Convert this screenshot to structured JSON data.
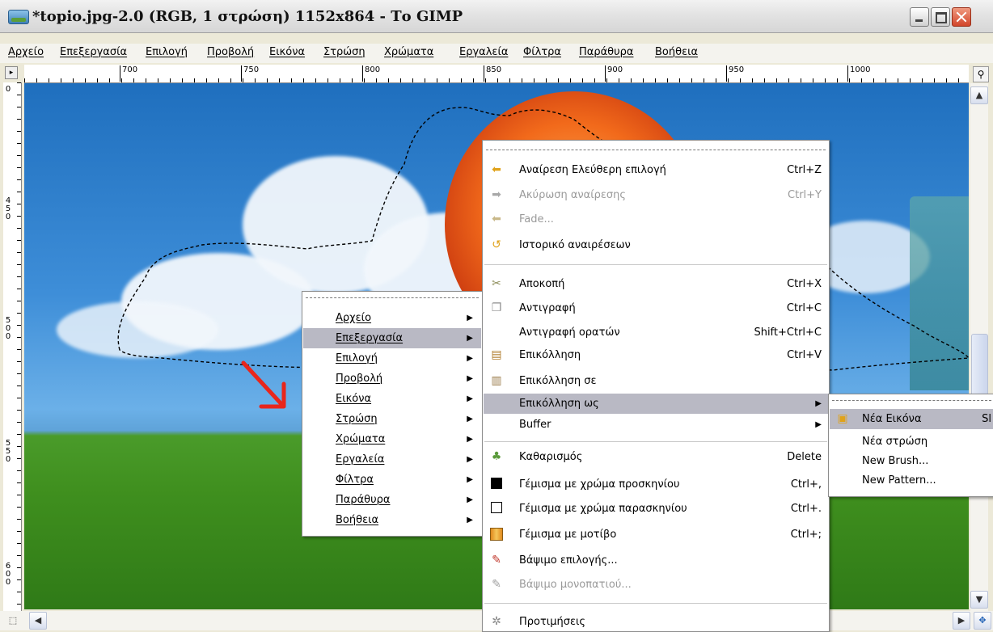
{
  "window": {
    "title": "*topio.jpg-2.0 (RGB, 1 στρώση) 1152x864 - Το GIMP"
  },
  "menubar": [
    "Αρχείο",
    "Επεξεργασία",
    "Επιλογή",
    "Προβολή",
    "Εικόνα",
    "Στρώση",
    "Χρώματα",
    "Εργαλεία",
    "Φίλτρα",
    "Παράθυρα",
    "Βοήθεια"
  ],
  "ruler": {
    "h_labels": [
      "700",
      "750",
      "800",
      "850",
      "900",
      "950",
      "1000"
    ],
    "v_labels": [
      "0",
      "4\n5\n0",
      "5\n0\n0",
      "5\n5\n0",
      "6\n0\n0"
    ]
  },
  "context_menu": {
    "items": [
      {
        "label": "Αρχείο",
        "submenu": true
      },
      {
        "label": "Επεξεργασία",
        "submenu": true,
        "highlighted": true
      },
      {
        "label": "Επιλογή",
        "submenu": true
      },
      {
        "label": "Προβολή",
        "submenu": true
      },
      {
        "label": "Εικόνα",
        "submenu": true
      },
      {
        "label": "Στρώση",
        "submenu": true
      },
      {
        "label": "Χρώματα",
        "submenu": true
      },
      {
        "label": "Εργαλεία",
        "submenu": true
      },
      {
        "label": "Φίλτρα",
        "submenu": true
      },
      {
        "label": "Παράθυρα",
        "submenu": true
      },
      {
        "label": "Βοήθεια",
        "submenu": true
      }
    ]
  },
  "edit_menu": {
    "items": [
      {
        "label": "Αναίρεση Ελεύθερη επιλογή",
        "shortcut": "Ctrl+Z",
        "icon": "undo-icon"
      },
      {
        "label": "Ακύρωση αναίρεσης",
        "shortcut": "Ctrl+Y",
        "icon": "redo-icon",
        "disabled": true
      },
      {
        "label": "Fade...",
        "shortcut": "",
        "icon": "fade-icon",
        "disabled": true
      },
      {
        "label": "Ιστορικό αναιρέσεων",
        "shortcut": "",
        "icon": "undo-history-icon"
      },
      {
        "label": "Αποκοπή",
        "shortcut": "Ctrl+X",
        "icon": "cut-icon"
      },
      {
        "label": "Αντιγραφή",
        "shortcut": "Ctrl+C",
        "icon": "copy-icon"
      },
      {
        "label": "Αντιγραφή ορατών",
        "shortcut": "Shift+Ctrl+C",
        "icon": ""
      },
      {
        "label": "Επικόλληση",
        "shortcut": "Ctrl+V",
        "icon": "paste-icon"
      },
      {
        "label": "Επικόλληση σε",
        "shortcut": "",
        "icon": "paste-into-icon"
      },
      {
        "label": "Επικόλληση ως",
        "shortcut": "",
        "icon": "",
        "submenu": true,
        "highlighted": true
      },
      {
        "label": "Buffer",
        "shortcut": "",
        "icon": "",
        "submenu": true
      },
      {
        "label": "Καθαρισμός",
        "shortcut": "Delete",
        "icon": "clear-icon"
      },
      {
        "label": "Γέμισμα με χρώμα προσκηνίου",
        "shortcut": "Ctrl+,",
        "icon": "fg-fill-icon"
      },
      {
        "label": "Γέμισμα με χρώμα παρασκηνίου",
        "shortcut": "Ctrl+.",
        "icon": "bg-fill-icon"
      },
      {
        "label": "Γέμισμα με μοτίβο",
        "shortcut": "Ctrl+;",
        "icon": "pattern-fill-icon"
      },
      {
        "label": "Βάψιμο επιλογής...",
        "shortcut": "",
        "icon": "stroke-selection-icon"
      },
      {
        "label": "Βάψιμο μονοπατιού...",
        "shortcut": "",
        "icon": "stroke-path-icon",
        "disabled": true
      },
      {
        "label": "Προτιμήσεις",
        "shortcut": "",
        "icon": "preferences-icon"
      }
    ]
  },
  "paste_as_menu": {
    "items": [
      {
        "label": "Νέα Εικόνα",
        "shortcut": "Sl",
        "highlighted": true,
        "icon": "new-image-icon"
      },
      {
        "label": "Νέα στρώση",
        "shortcut": ""
      },
      {
        "label": "New Brush...",
        "shortcut": ""
      },
      {
        "label": "New Pattern...",
        "shortcut": ""
      }
    ]
  }
}
